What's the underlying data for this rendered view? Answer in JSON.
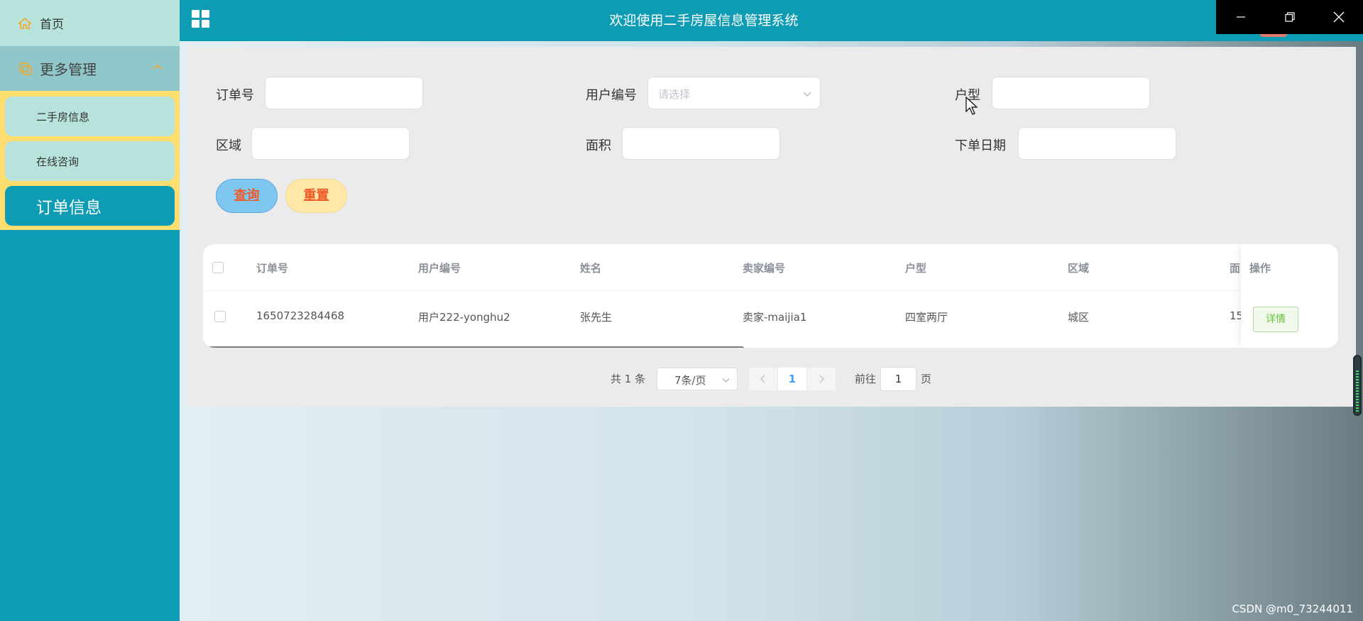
{
  "sidebar": {
    "home": "首页",
    "more": "更多管理",
    "items": [
      "二手房信息",
      "在线咨询",
      "订单信息"
    ]
  },
  "header": {
    "title": "欢迎使用二手房屋信息管理系统"
  },
  "search": {
    "order_no_label": "订单号",
    "user_no_label": "用户编号",
    "user_no_placeholder": "请选择",
    "house_type_label": "户型",
    "area_label": "区域",
    "size_label": "面积",
    "order_date_label": "下单日期",
    "query_label": "查询",
    "reset_label": "重置"
  },
  "table": {
    "headers": [
      "订单号",
      "用户编号",
      "姓名",
      "卖家编号",
      "户型",
      "区域",
      "面"
    ],
    "op_header": "操作",
    "rows": [
      {
        "order_no": "1650723284468",
        "user_no": "用户222-yonghu2",
        "name": "张先生",
        "seller_no": "卖家-maijia1",
        "house_type": "四室两厅",
        "area": "城区",
        "size": "15",
        "detail": "详情"
      }
    ]
  },
  "pager": {
    "total": "共 1 条",
    "page_size": "7条/页",
    "current": "1",
    "goto_prefix": "前往",
    "goto_value": "1",
    "goto_suffix": "页"
  },
  "watermark": "CSDN @m0_73244011",
  "colors": {
    "primary": "#0e9cb5",
    "accent": "#ffdd6e",
    "query": "#7ec8ef",
    "reset": "#ffe7a8"
  }
}
